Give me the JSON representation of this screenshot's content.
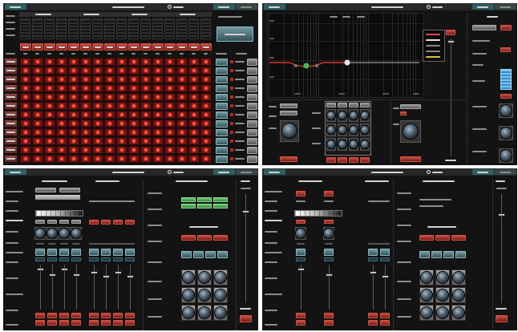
{
  "colors": {
    "page_background": "#ffffff",
    "panel_background": "#131313",
    "top_bar": "#282828",
    "tab_active": "#2e5f63",
    "accent_red": "#b8291f",
    "accent_teal": "#4f7f89",
    "accent_green": "#4bb654",
    "meter_blue": "#2f8fd0"
  },
  "icons": {
    "top_bar_status": "status-icon",
    "knob": "rotary-knob-icon",
    "fader": "fader-handle-icon"
  }
}
